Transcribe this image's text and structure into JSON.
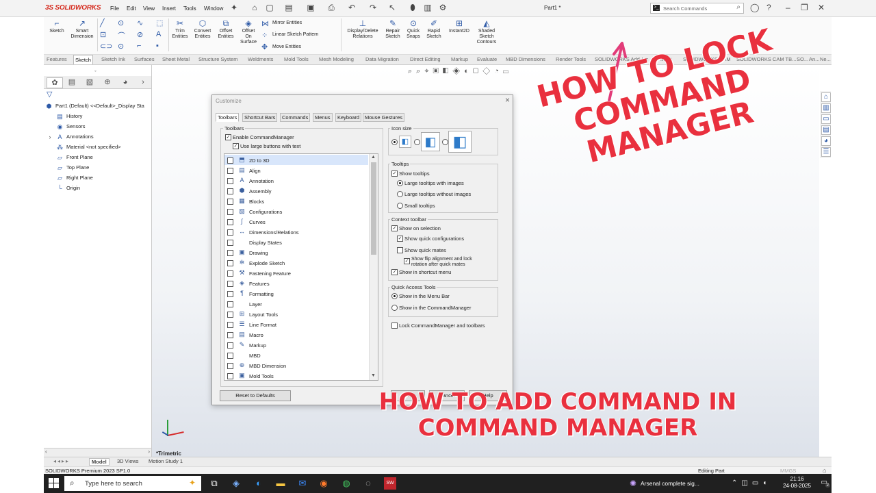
{
  "app": {
    "logo_text": "3S SOLIDWORKS",
    "menu": [
      "File",
      "Edit",
      "View",
      "Insert",
      "Tools",
      "Window"
    ],
    "document_title": "Part1 *",
    "search_placeholder": "Search Commands"
  },
  "ribbon": {
    "buttons": [
      {
        "label": "Sketch"
      },
      {
        "label": "Smart\nDimension"
      },
      {
        "label": "Trim\nEntities"
      },
      {
        "label": "Convert\nEntities"
      },
      {
        "label": "Offset\nEntities"
      },
      {
        "label": "Offset\nOn\nSurface"
      },
      {
        "label": "Display/Delete\nRelations"
      },
      {
        "label": "Repair\nSketch"
      },
      {
        "label": "Quick\nSnaps"
      },
      {
        "label": "Rapid\nSketch"
      },
      {
        "label": "Instant2D"
      },
      {
        "label": "Shaded\nSketch\nContours"
      }
    ],
    "mirror": "Mirror Entities",
    "linear_pattern": "Linear Sketch Pattern",
    "move": "Move Entities"
  },
  "command_tabs": [
    "Features",
    "Sketch",
    "Sketch Ink",
    "Surfaces",
    "Sheet Metal",
    "Structure System",
    "Weldments",
    "Mold Tools",
    "Mesh Modeling",
    "Data Migration",
    "Direct Editing",
    "Markup",
    "Evaluate",
    "MBD Dimensions",
    "Render Tools",
    "SOLIDWORKS Add-Ins",
    "MBD",
    "SOLIDWORKS CAM",
    "SOLIDWORKS CAM TB...",
    "SO...",
    "An...",
    "Ne..."
  ],
  "active_tab": "Sketch",
  "feature_tree": [
    "Part1 (Default) <<Default>_Display Sta",
    "History",
    "Sensors",
    "Annotations",
    "Material <not specified>",
    "Front Plane",
    "Top Plane",
    "Right Plane",
    "Origin"
  ],
  "view_label": "*Trimetric",
  "dialog": {
    "title": "Customize",
    "tabs": [
      "Toolbars",
      "Shortcut Bars",
      "Commands",
      "Menus",
      "Keyboard",
      "Mouse Gestures"
    ],
    "toolbars_group": "Toolbars",
    "enable_cm": "Enable CommandManager",
    "large_buttons": "Use large buttons with text",
    "toolbar_items": [
      "2D to 3D",
      "Align",
      "Annotation",
      "Assembly",
      "Blocks",
      "Configurations",
      "Curves",
      "Dimensions/Relations",
      "Display States",
      "Drawing",
      "Explode Sketch",
      "Fastening Feature",
      "Features",
      "Formatting",
      "Layer",
      "Layout Tools",
      "Line Format",
      "Macro",
      "Markup",
      "MBD",
      "MBD Dimension",
      "Mold Tools"
    ],
    "icon_size": "Icon size",
    "tooltips": "Tooltips",
    "show_tooltips": "Show tooltips",
    "large_tt_images": "Large tooltips with images",
    "large_tt_no_images": "Large tooltips without images",
    "small_tt": "Small tooltips",
    "context_toolbar": "Context toolbar",
    "show_on_selection": "Show on selection",
    "show_quick_configs": "Show quick configurations",
    "show_quick_mates": "Show quick mates",
    "show_flip": "Show flip alignment and lock\nrotation after quick mates",
    "show_in_shortcut": "Show in shortcut menu",
    "quick_access": "Quick Access Tools",
    "show_in_menubar": "Show in the Menu Bar",
    "show_in_cm": "Show in the CommandManager",
    "lock_cm": "Lock CommandManager and toolbars",
    "reset": "Reset to Defaults",
    "ok": "OK",
    "cancel": "Cancel",
    "help": "Help"
  },
  "overlay": {
    "lock_line1": "HOW TO LOCK",
    "lock_line2": "COMMAND",
    "lock_line3": "MANAGER",
    "add_line1": "HOW TO ADD COMMAND IN",
    "add_line2": "COMMAND MANAGER",
    "color": "#e9303e"
  },
  "model_tabs": [
    "Model",
    "3D Views",
    "Motion Study 1"
  ],
  "status": {
    "version": "SOLIDWORKS Premium 2023 SP1.0",
    "mode": "Editing Part",
    "units": "MMGS"
  },
  "taskbar": {
    "search_placeholder": "Type here to search",
    "notification": "Arsenal complete sig...",
    "time": "21:16",
    "date": "24-08-2025",
    "badge": "2"
  }
}
